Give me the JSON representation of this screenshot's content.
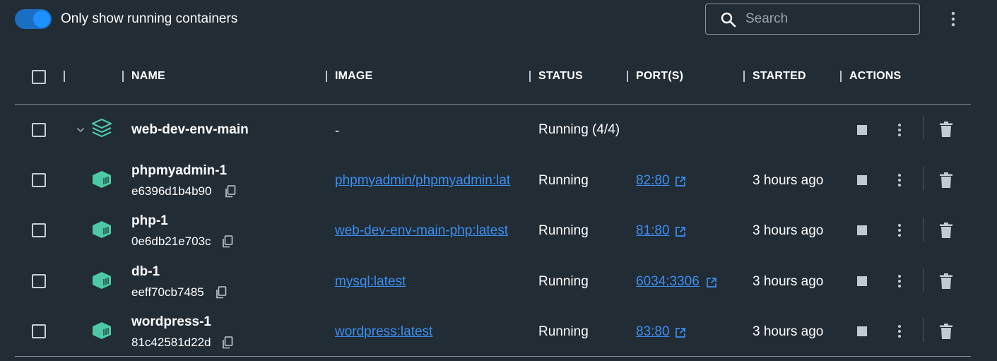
{
  "toolbar": {
    "toggle_label": "Only show running containers",
    "search_placeholder": "Search",
    "search_value": ""
  },
  "columns": [
    "NAME",
    "IMAGE",
    "STATUS",
    "PORT(S)",
    "STARTED",
    "ACTIONS"
  ],
  "group": {
    "name": "web-dev-env-main",
    "image": "-",
    "status": "Running (4/4)"
  },
  "containers": [
    {
      "name": "phpmyadmin-1",
      "id": "e6396d1b4b90",
      "image": "phpmyadmin/phpmyadmin:lat",
      "status": "Running",
      "port": "82:80",
      "started": "3 hours ago"
    },
    {
      "name": "php-1",
      "id": "0e6db21e703c",
      "image": "web-dev-env-main-php:latest",
      "status": "Running",
      "port": "81:80",
      "started": "3 hours ago"
    },
    {
      "name": "db-1",
      "id": "eeff70cb7485",
      "image": "mysql:latest",
      "status": "Running",
      "port": "6034:3306",
      "started": "3 hours ago"
    },
    {
      "name": "wordpress-1",
      "id": "81c42581d22d",
      "image": "wordpress:latest",
      "status": "Running",
      "port": "83:80",
      "started": "3 hours ago"
    }
  ],
  "colors": {
    "background": "#212c35",
    "accent": "#1e90ff",
    "link": "#3d8ef0",
    "container_icon": "#4ec9a6"
  },
  "icons": {
    "search": "search-icon",
    "menu": "kebab-menu-icon",
    "group": "stack-icon",
    "container": "container-icon",
    "copy": "copy-icon",
    "external": "external-link-icon",
    "stop": "stop-icon",
    "delete": "trash-icon"
  }
}
